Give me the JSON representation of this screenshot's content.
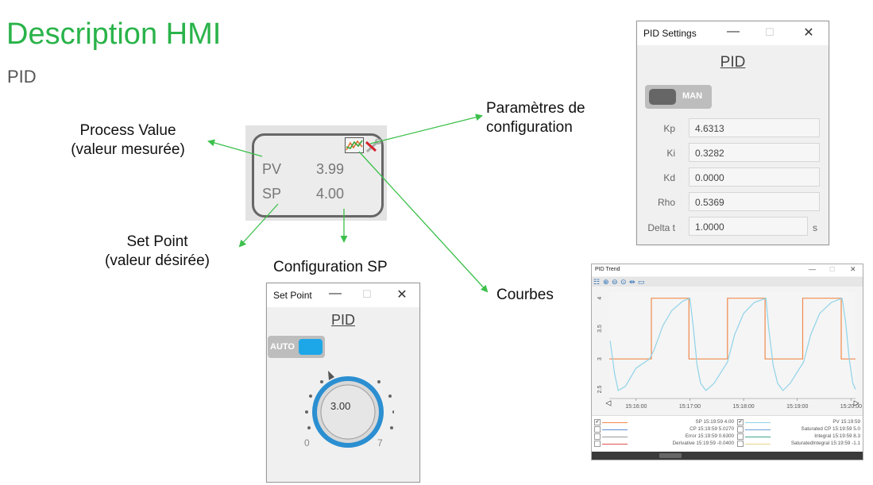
{
  "page": {
    "title": "Description HMI",
    "subtitle": "PID"
  },
  "callouts": {
    "process_value_1": "Process Value",
    "process_value_2": "(valeur mesurée)",
    "set_point_1": "Set Point",
    "set_point_2": "(valeur désirée)",
    "config_sp": "Configuration SP",
    "param_config_1": "Paramètres de",
    "param_config_2": "configuration",
    "courbes": "Courbes"
  },
  "faceplate": {
    "pv_label": "PV",
    "pv_value": "3.99",
    "sp_label": "SP",
    "sp_value": "4.00",
    "trend_icon": "trend-chart-icon",
    "settings_icon": "wrench-screwdriver-icon"
  },
  "pid_settings": {
    "window_title": "PID Settings",
    "heading": "PID",
    "mode_label": "MAN",
    "params": [
      {
        "label": "Kp",
        "value": "4.6313"
      },
      {
        "label": "Ki",
        "value": "0.3282"
      },
      {
        "label": "Kd",
        "value": "0.0000"
      },
      {
        "label": "Rho",
        "value": "0.5369"
      },
      {
        "label": "Delta t",
        "value": "1.0000"
      }
    ],
    "delta_unit": "s"
  },
  "set_point_window": {
    "window_title": "Set Point",
    "heading": "PID",
    "mode_label": "AUTO",
    "knob_value": "3.00",
    "scale_min": "0",
    "scale_max": "7"
  },
  "window_controls": {
    "minimize": "—",
    "maximize": "☐",
    "close": "✕"
  },
  "pid_trend": {
    "window_title": "PID Trend",
    "legend": [
      {
        "checked": true,
        "text": "SP 15:19:59     4.00"
      },
      {
        "checked": false,
        "text": "CP 15:19:59   5.0270"
      },
      {
        "checked": false,
        "text": "Error 15:19:59   0.6300"
      },
      {
        "checked": false,
        "text": "Derivative 15:19:59  -0.0400"
      },
      {
        "checked": true,
        "text": "PV 15:19:59"
      },
      {
        "checked": false,
        "text": "Saturated CP 15:19:59   5.0"
      },
      {
        "checked": false,
        "text": "Integral 15:19:59   8.3"
      },
      {
        "checked": false,
        "text": "SaturatedIntegral 15:19:59  -1.1"
      }
    ]
  },
  "colors": {
    "title_green": "#2ab34a",
    "arrow_green": "#3cc04b",
    "sp_line": "#f08a4b",
    "pv_line": "#8fd3e8",
    "auto_blue": "#1ea7e8",
    "knob_ring": "#2b8fd1"
  },
  "chart_data": {
    "type": "line",
    "title": "",
    "xlabel": "",
    "ylabel": "",
    "x_ticks": [
      "15:16:00",
      "15:17:00",
      "15:18:00",
      "15:19:00",
      "15:20:00"
    ],
    "y_ticks": [
      "2.5",
      "3",
      "3.5",
      "4"
    ],
    "ylim": [
      2.35,
      4.1
    ],
    "series": [
      {
        "name": "SP",
        "points": [
          [
            "15:15:30",
            3.0
          ],
          [
            "15:16:17",
            3.0
          ],
          [
            "15:16:17",
            4.0
          ],
          [
            "15:16:59",
            4.0
          ],
          [
            "15:16:59",
            3.0
          ],
          [
            "15:17:42",
            3.0
          ],
          [
            "15:17:42",
            4.0
          ],
          [
            "15:18:24",
            4.0
          ],
          [
            "15:18:24",
            3.0
          ],
          [
            "15:19:06",
            3.0
          ],
          [
            "15:19:06",
            4.0
          ],
          [
            "15:19:49",
            4.0
          ],
          [
            "15:19:49",
            3.0
          ],
          [
            "15:20:05",
            3.0
          ]
        ]
      },
      {
        "name": "PV",
        "points": [
          [
            "15:15:31",
            3.3
          ],
          [
            "15:15:36",
            2.75
          ],
          [
            "15:15:40",
            2.48
          ],
          [
            "15:15:48",
            2.55
          ],
          [
            "15:16:00",
            2.85
          ],
          [
            "15:16:15",
            3.0
          ],
          [
            "15:16:20",
            3.15
          ],
          [
            "15:16:30",
            3.55
          ],
          [
            "15:16:40",
            3.8
          ],
          [
            "15:16:52",
            3.95
          ],
          [
            "15:17:00",
            4.0
          ],
          [
            "15:17:04",
            3.5
          ],
          [
            "15:17:08",
            2.9
          ],
          [
            "15:17:12",
            2.6
          ],
          [
            "15:17:18",
            2.48
          ],
          [
            "15:17:27",
            2.6
          ],
          [
            "15:17:42",
            2.95
          ],
          [
            "15:17:50",
            3.4
          ],
          [
            "15:18:00",
            3.75
          ],
          [
            "15:18:12",
            3.93
          ],
          [
            "15:18:25",
            4.0
          ],
          [
            "15:18:28",
            3.5
          ],
          [
            "15:18:33",
            2.9
          ],
          [
            "15:18:38",
            2.6
          ],
          [
            "15:18:44",
            2.48
          ],
          [
            "15:18:52",
            2.6
          ],
          [
            "15:19:07",
            2.95
          ],
          [
            "15:19:15",
            3.4
          ],
          [
            "15:19:25",
            3.75
          ],
          [
            "15:19:38",
            3.93
          ],
          [
            "15:19:50",
            4.0
          ],
          [
            "15:19:54",
            3.6
          ],
          [
            "15:19:58",
            3.0
          ],
          [
            "15:20:02",
            2.6
          ],
          [
            "15:20:05",
            2.5
          ]
        ]
      }
    ]
  }
}
